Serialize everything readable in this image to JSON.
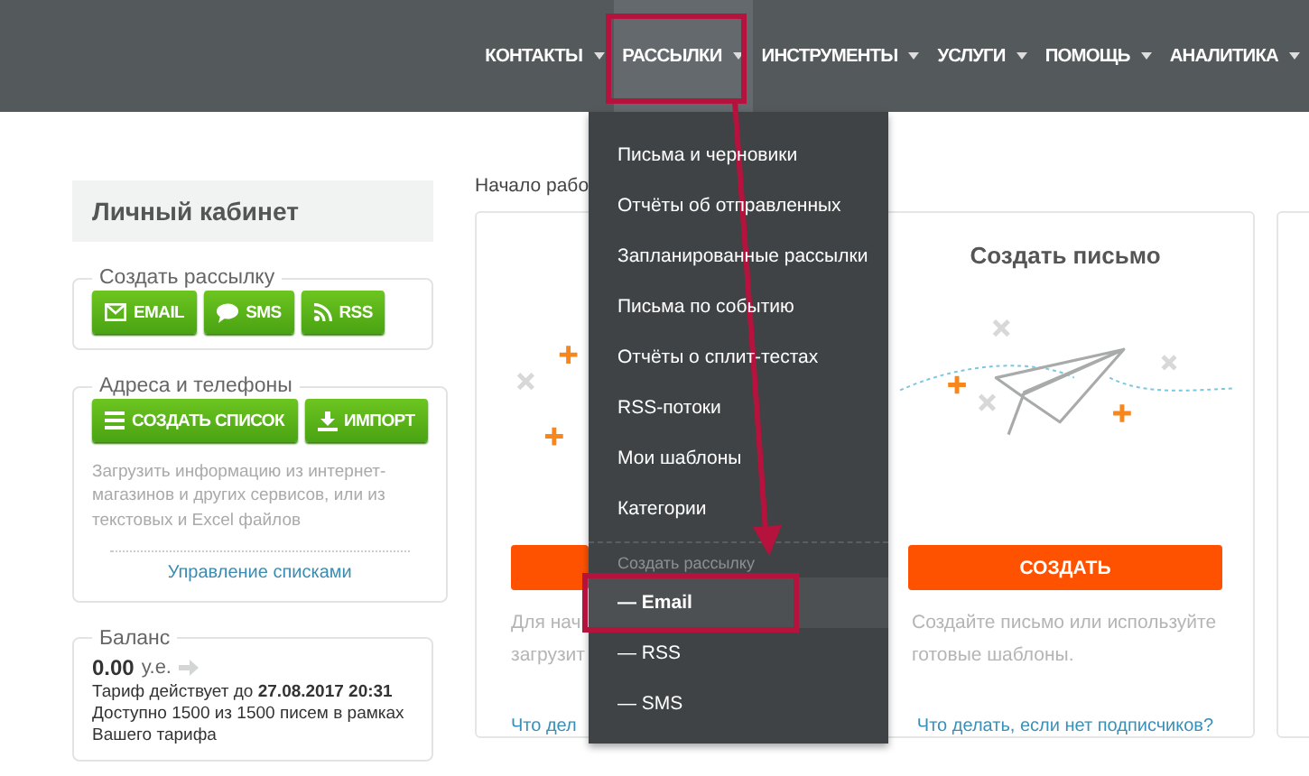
{
  "nav": {
    "items": [
      {
        "label": "КОНТАКТЫ",
        "selected": false
      },
      {
        "label": "РАССЫЛКИ",
        "selected": true
      },
      {
        "label": "ИНСТРУМЕНТЫ",
        "selected": false
      },
      {
        "label": "УСЛУГИ",
        "selected": false
      },
      {
        "label": "ПОМОЩЬ",
        "selected": false
      },
      {
        "label": "АНАЛИТИКА",
        "selected": false
      }
    ]
  },
  "dropdown": {
    "items": [
      "Письма и черновики",
      "Отчёты об отправленных",
      "Запланированные рассылки",
      "Письма по событию",
      "Отчёты о сплит-тестах",
      "RSS-потоки",
      "Мои шаблоны",
      "Категории"
    ],
    "section_label": "Создать рассылку",
    "sub_items": [
      {
        "label": "— Email",
        "selected": true
      },
      {
        "label": "— RSS",
        "selected": false
      },
      {
        "label": "— SMS",
        "selected": false
      }
    ]
  },
  "sidebar": {
    "title": "Личный кабинет",
    "create": {
      "legend": "Создать рассылку",
      "buttons": [
        {
          "kind": "email",
          "label": "EMAIL"
        },
        {
          "kind": "sms",
          "label": "SMS"
        },
        {
          "kind": "rss",
          "label": "RSS"
        }
      ]
    },
    "addresses": {
      "legend": "Адреса и телефоны",
      "buttons": [
        {
          "kind": "list",
          "label": "СОЗДАТЬ СПИСОК"
        },
        {
          "kind": "import",
          "label": "ИМПОРТ"
        }
      ],
      "hint": "Загрузить информацию из интернет-магазинов и других сервисов, или из текстовых и Excel файлов",
      "link": "Управление списками"
    },
    "balance": {
      "legend": "Баланс",
      "amount": "0.00",
      "unit": "у.е.",
      "tariff": "Тариф действует до **27.08.2017 20:31**",
      "available": "Доступно 1500 из 1500 писем в рамках Вашего тарифа"
    }
  },
  "main": {
    "heading": "Начало рабо",
    "cards": [
      {
        "text_lines": [
          "Для нач",
          "загрузит"
        ],
        "link": "Что дел"
      },
      {
        "title": "Создать письмо",
        "button": "СОЗДАТЬ",
        "text_lines": [
          "Создайте письмо или используйте готовые шаблоны."
        ],
        "link": "Что делать, если нет подписчиков?"
      }
    ]
  }
}
